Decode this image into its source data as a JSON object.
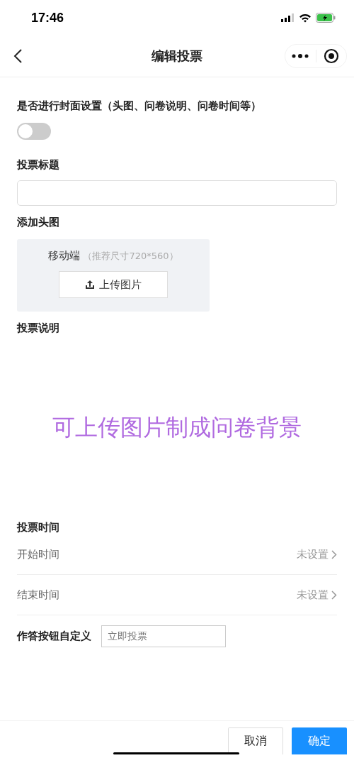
{
  "status_bar": {
    "time": "17:46"
  },
  "nav": {
    "title": "编辑投票"
  },
  "cover_setting": {
    "label": "是否进行封面设置（头图、问卷说明、问卷时间等）",
    "on": false
  },
  "title_field": {
    "label": "投票标题"
  },
  "header_image": {
    "label": "添加头图",
    "platform": "移动端",
    "hint": "（推荐尺寸720*560）",
    "upload_button": "上传图片"
  },
  "description": {
    "label": "投票说明",
    "note": "可上传图片制成问卷背景"
  },
  "time": {
    "label": "投票时间",
    "rows": [
      {
        "label": "开始时间",
        "value": "未设置"
      },
      {
        "label": "结束时间",
        "value": "未设置"
      }
    ]
  },
  "answer_button": {
    "label": "作答按钮自定义",
    "placeholder": "立即投票"
  },
  "footer": {
    "cancel": "取消",
    "confirm": "确定"
  }
}
